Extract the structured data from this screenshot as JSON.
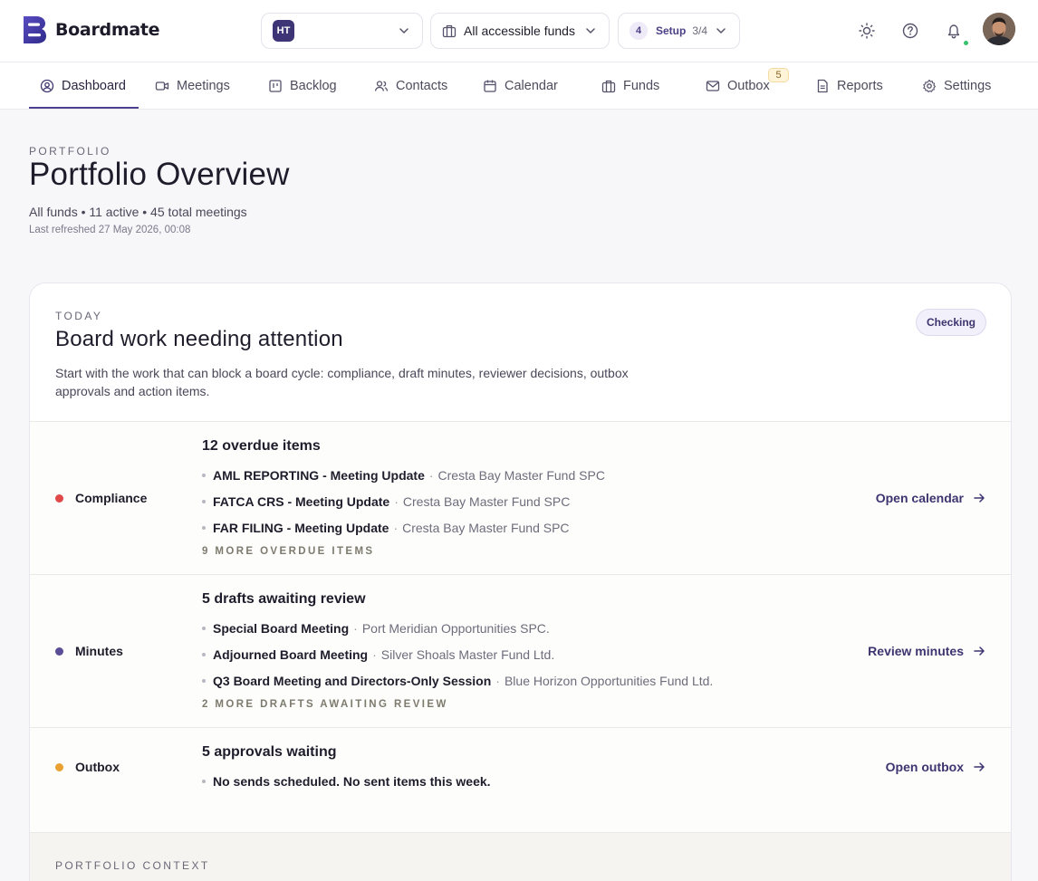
{
  "app": {
    "name": "Boardmate"
  },
  "header": {
    "org_initials": "HT",
    "funds_selector": "All accessible funds",
    "setup": {
      "step": "4",
      "label": "Setup",
      "progress": "3/4"
    }
  },
  "nav": {
    "items": [
      {
        "label": "Dashboard",
        "icon": "user-circle-icon"
      },
      {
        "label": "Meetings",
        "icon": "video-icon"
      },
      {
        "label": "Backlog",
        "icon": "board-icon"
      },
      {
        "label": "Contacts",
        "icon": "users-icon"
      },
      {
        "label": "Calendar",
        "icon": "calendar-icon"
      },
      {
        "label": "Funds",
        "icon": "briefcase-icon"
      },
      {
        "label": "Outbox",
        "icon": "mail-icon",
        "badge": "5"
      },
      {
        "label": "Reports",
        "icon": "document-icon"
      },
      {
        "label": "Settings",
        "icon": "gear-icon"
      }
    ],
    "active": "Dashboard"
  },
  "page": {
    "eyebrow": "PORTFOLIO",
    "title": "Portfolio Overview",
    "subtitle": "All funds • 11 active • 45 total meetings",
    "refreshed": "Last refreshed 27 May 2026, 00:08"
  },
  "attention": {
    "eyebrow": "TODAY",
    "title": "Board work needing attention",
    "status": "Checking",
    "description": "Start with the work that can block a board cycle: compliance, draft minutes, reviewer decisions, outbox approvals and action items.",
    "rows": [
      {
        "label": "Compliance",
        "color": "#e0484a",
        "headline": "12 overdue items",
        "items": [
          {
            "name": "AML REPORTING - Meeting Update",
            "fund": "Cresta Bay Master Fund SPC"
          },
          {
            "name": "FATCA CRS - Meeting Update",
            "fund": "Cresta Bay Master Fund SPC"
          },
          {
            "name": "FAR FILING - Meeting Update",
            "fund": "Cresta Bay Master Fund SPC"
          }
        ],
        "more": "9 MORE OVERDUE ITEMS",
        "action": "Open calendar"
      },
      {
        "label": "Minutes",
        "color": "#5b4c97",
        "headline": "5 drafts awaiting review",
        "items": [
          {
            "name": "Special Board Meeting",
            "fund": "Port Meridian Opportunities SPC."
          },
          {
            "name": "Adjourned Board Meeting",
            "fund": "Silver Shoals Master Fund Ltd."
          },
          {
            "name": "Q3 Board Meeting and Directors-Only Session",
            "fund": "Blue Horizon Opportunities Fund Ltd."
          }
        ],
        "more": "2 MORE DRAFTS AWAITING REVIEW",
        "action": "Review minutes"
      },
      {
        "label": "Outbox",
        "color": "#e9a232",
        "headline": "5 approvals waiting",
        "items": [
          {
            "name": "No sends scheduled. No sent items this week.",
            "fund": ""
          }
        ],
        "more": "",
        "action": "Open outbox"
      }
    ]
  },
  "context": {
    "eyebrow": "PORTFOLIO CONTEXT"
  }
}
